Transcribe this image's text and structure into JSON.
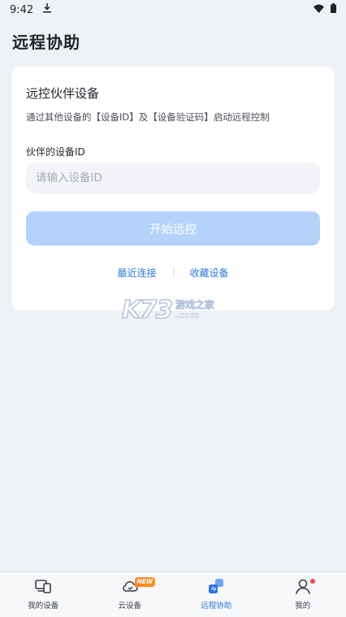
{
  "status_bar": {
    "time": "9:42",
    "download_icon": "download-icon",
    "wifi_icon": "wifi-icon",
    "battery_icon": "battery-icon"
  },
  "page": {
    "title": "远程协助"
  },
  "card": {
    "title": "远控伙伴设备",
    "description": "通过其他设备的【设备ID】及【设备验证码】启动远程控制",
    "field_label": "伙伴的设备ID",
    "input_placeholder": "请输入设备ID",
    "input_value": "",
    "start_button": "开始远控",
    "links": {
      "recent": "最近连接",
      "favorites": "收藏设备"
    }
  },
  "watermark": {
    "logo": "K73",
    "text": "游戏之家",
    "domain": ".com"
  },
  "bottom_nav": {
    "items": [
      {
        "label": "我的设备",
        "icon": "devices-icon"
      },
      {
        "label": "云设备",
        "icon": "cloud-icon",
        "badge": "NEW"
      },
      {
        "label": "远程协助",
        "icon": "remote-assist-icon",
        "active": true
      },
      {
        "label": "我的",
        "icon": "profile-icon"
      }
    ]
  },
  "colors": {
    "accent": "#2b78e4",
    "button_disabled": "#b4d3fa",
    "background": "#eef2f6",
    "badge": "#ff8a1f",
    "notify_dot": "#f5454a"
  }
}
